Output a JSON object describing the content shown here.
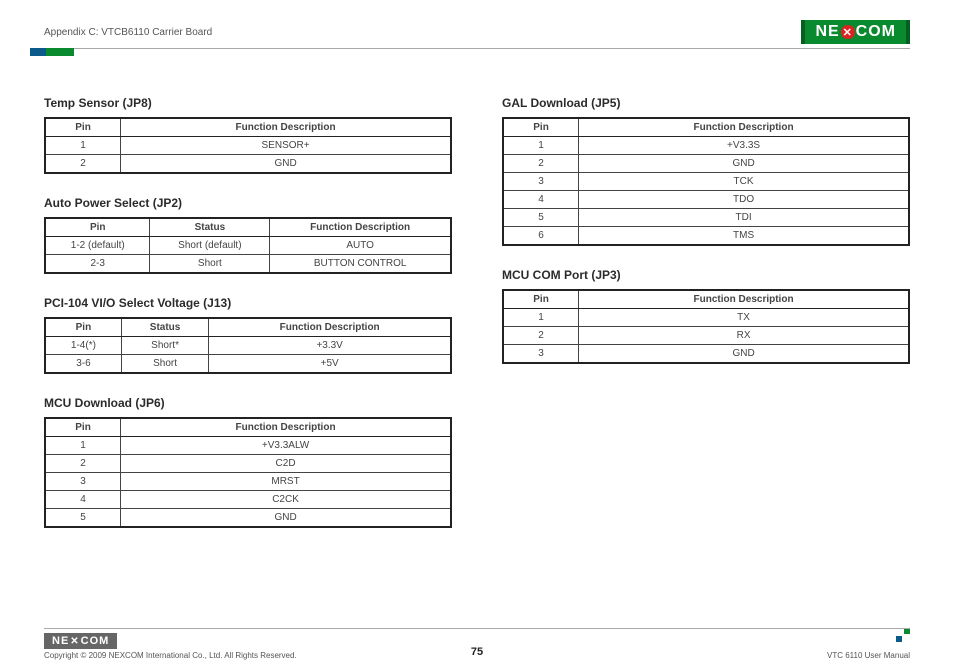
{
  "header": {
    "title": "Appendix C: VTCB6110 Carrier Board",
    "logo_left": "NE",
    "logo_x": "✕",
    "logo_right": "COM"
  },
  "left_col": {
    "s1": {
      "title": "Temp Sensor (JP8)",
      "h1": "Pin",
      "h2": "Function Description",
      "rows": [
        {
          "c1": "1",
          "c2": "SENSOR+"
        },
        {
          "c1": "2",
          "c2": "GND"
        }
      ]
    },
    "s2": {
      "title": "Auto Power Select (JP2)",
      "h1": "Pin",
      "h2": "Status",
      "h3": "Function Description",
      "rows": [
        {
          "c1": "1-2 (default)",
          "c2": "Short (default)",
          "c3": "AUTO"
        },
        {
          "c1": "2-3",
          "c2": "Short",
          "c3": "BUTTON CONTROL"
        }
      ]
    },
    "s3": {
      "title": "PCI-104 VI/O Select Voltage (J13)",
      "h1": "Pin",
      "h2": "Status",
      "h3": "Function Description",
      "rows": [
        {
          "c1": "1-4(*)",
          "c2": "Short*",
          "c3": "+3.3V"
        },
        {
          "c1": "3-6",
          "c2": "Short",
          "c3": "+5V"
        }
      ]
    },
    "s4": {
      "title": "MCU Download (JP6)",
      "h1": "Pin",
      "h2": "Function Description",
      "rows": [
        {
          "c1": "1",
          "c2": "+V3.3ALW"
        },
        {
          "c1": "2",
          "c2": "C2D"
        },
        {
          "c1": "3",
          "c2": "MRST"
        },
        {
          "c1": "4",
          "c2": "C2CK"
        },
        {
          "c1": "5",
          "c2": "GND"
        }
      ]
    }
  },
  "right_col": {
    "s1": {
      "title": "GAL Download (JP5)",
      "h1": "Pin",
      "h2": "Function Description",
      "rows": [
        {
          "c1": "1",
          "c2": "+V3.3S"
        },
        {
          "c1": "2",
          "c2": "GND"
        },
        {
          "c1": "3",
          "c2": "TCK"
        },
        {
          "c1": "4",
          "c2": "TDO"
        },
        {
          "c1": "5",
          "c2": "TDI"
        },
        {
          "c1": "6",
          "c2": "TMS"
        }
      ]
    },
    "s2": {
      "title": "MCU COM Port (JP3)",
      "h1": "Pin",
      "h2": "Function Description",
      "rows": [
        {
          "c1": "1",
          "c2": "TX"
        },
        {
          "c1": "2",
          "c2": "RX"
        },
        {
          "c1": "3",
          "c2": "GND"
        }
      ]
    }
  },
  "footer": {
    "copyright": "Copyright © 2009 NEXCOM International Co., Ltd. All Rights Reserved.",
    "page": "75",
    "manual": "VTC 6110 User Manual"
  }
}
